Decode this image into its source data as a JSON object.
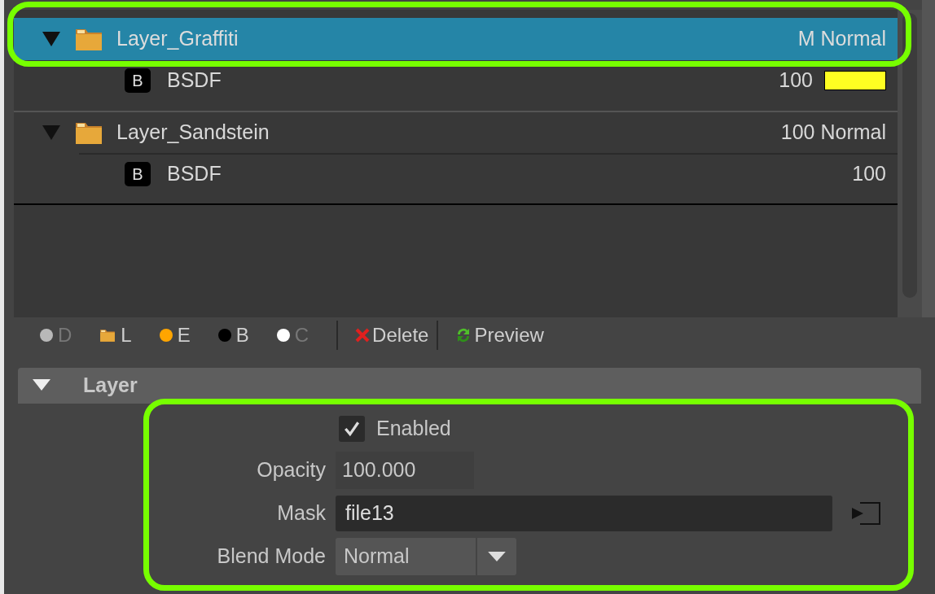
{
  "tree": [
    {
      "label": "Layer_Graffiti",
      "value": "M Normal",
      "selected": true,
      "expanded": true,
      "children": [
        {
          "badge": "B",
          "label": "BSDF",
          "value": "100",
          "color": "#ffff22"
        }
      ]
    },
    {
      "label": "Layer_Sandstein",
      "value": "100 Normal",
      "selected": false,
      "expanded": true,
      "children": [
        {
          "badge": "B",
          "label": "BSDF",
          "value": "100"
        }
      ]
    }
  ],
  "toolbar": {
    "filters": [
      {
        "kind": "dot",
        "label": "D",
        "color": "#b8b8b8",
        "disabled": true
      },
      {
        "kind": "folder",
        "label": "L",
        "disabled": false
      },
      {
        "kind": "dot",
        "label": "E",
        "color": "#ffa500",
        "disabled": false
      },
      {
        "kind": "dot",
        "label": "B",
        "color": "#000000",
        "disabled": false
      },
      {
        "kind": "dot",
        "label": "C",
        "color": "#ffffff",
        "disabled": true
      }
    ],
    "buttons": [
      {
        "kind": "delete",
        "label": "Delete"
      },
      {
        "kind": "preview",
        "label": "Preview"
      }
    ]
  },
  "section": {
    "title": "Layer",
    "expanded": true,
    "enabled": {
      "label": "Enabled",
      "checked": true
    },
    "opacity": {
      "label": "Opacity",
      "value": "100.000"
    },
    "mask": {
      "label": "Mask",
      "value": "file13"
    },
    "blend_mode": {
      "label": "Blend Mode",
      "value": "Normal"
    }
  }
}
